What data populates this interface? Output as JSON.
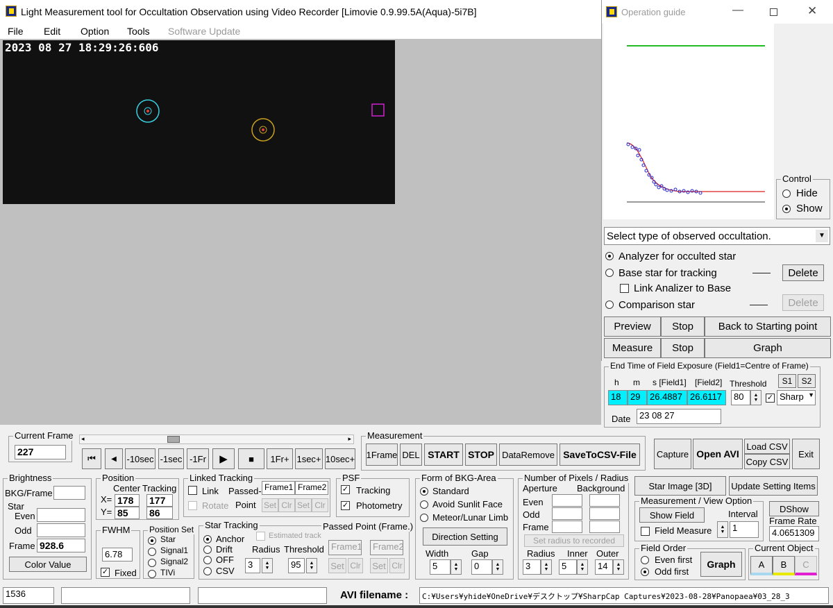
{
  "main": {
    "title": "Light Measurement tool for Occultation Observation using Video Recorder [Limovie 0.9.99.5A(Aqua)-5i7B]",
    "menu": [
      "File",
      "Edit",
      "Option",
      "Tools",
      "Software Update"
    ],
    "video_timestamp": "2023 08 27 18:29:26:606"
  },
  "guide": {
    "title": "Operation guide",
    "control_label": "Control",
    "hide_label": "Hide",
    "show_label": "Show",
    "select_text": "Select type of observed occultation.",
    "analyzer_label": "Analyzer for occulted star",
    "base_label": "Base star for tracking",
    "link_label": "Link Analizer to Base",
    "comparison_label": "Comparison star",
    "delete1": "Delete",
    "delete2": "Delete",
    "preview": "Preview",
    "stop1": "Stop",
    "back": "Back to Starting point",
    "measure": "Measure",
    "stop2": "Stop",
    "graph": "Graph",
    "dash1": "——",
    "dash2": "——"
  },
  "endtime": {
    "title": "End Time of Field Exposure (Field1=Centre of Frame)",
    "h_label": "h",
    "m_label": "m",
    "s_label": "s [Field1]",
    "f2_label": "[Field2]",
    "threshold_label": "Threshold",
    "s1": "S1",
    "s2": "S2",
    "h": "18",
    "m": "29",
    "s1_val": "26.4887",
    "s2_val": "26.6117",
    "threshold": "80",
    "sharp": "Sharp",
    "date_label": "Date",
    "date": "23 08 27"
  },
  "frame": {
    "current_label": "Current Frame",
    "current": "227",
    "nav": [
      "⏮",
      "◀",
      "-10sec",
      "-1sec",
      "-1Fr",
      "▶",
      "■",
      "1Fr+",
      "1sec+",
      "10sec+"
    ]
  },
  "measurement": {
    "title": "Measurement",
    "buttons": [
      "1Frame",
      "DEL",
      "START",
      "STOP",
      "DataRemove",
      "SaveToCSV-File"
    ]
  },
  "right_buttons": {
    "capture": "Capture",
    "open_avi": "Open AVI",
    "load_csv": "Load CSV",
    "copy_csv": "Copy CSV",
    "exit": "Exit",
    "star_image": "Star Image [3D]",
    "update": "Update Setting Items"
  },
  "brightness": {
    "title": "Brightness",
    "bkg_label": "BKG/Frame",
    "star_label": "Star",
    "even_label": "Even",
    "odd_label": "Odd",
    "frame_label": "Frame",
    "frame_value": "928.6",
    "color_value": "Color Value"
  },
  "position": {
    "title": "Position",
    "center": "Center",
    "tracking": "Tracking",
    "x_label": "X=",
    "y_label": "Y=",
    "cx": "178",
    "cy": "85",
    "tx": "177",
    "ty": "86"
  },
  "fwhm": {
    "title": "FWHM",
    "value": "6.78",
    "fixed": "Fixed"
  },
  "position_set": {
    "title": "Position Set",
    "options": [
      "Star",
      "Signal1",
      "Signal2",
      "TIVi"
    ]
  },
  "linked": {
    "title": "Linked Tracking",
    "link": "Link",
    "rotate": "Rotate",
    "passed": "Passed-",
    "point": "Point",
    "frame1": "Frame1",
    "frame2": "Frame2",
    "set": "Set",
    "clr": "Clr"
  },
  "star_tracking": {
    "title": "Star Tracking",
    "options": [
      "Anchor",
      "Drift",
      "OFF",
      "CSV"
    ],
    "estimated": "Estimated track",
    "radius_label": "Radius",
    "threshold_label": "Threshold",
    "radius": "3",
    "threshold": "95",
    "passed_label": "Passed Point (Frame.)",
    "frame1": "Frame1",
    "frame2": "Frame2",
    "set": "Set",
    "clr": "Clr"
  },
  "psf": {
    "title": "PSF",
    "tracking": "Tracking",
    "photometry": "Photometry"
  },
  "bkg_area": {
    "title": "Form of BKG-Area",
    "options": [
      "Standard",
      "Avoid Sunlit Face",
      "Meteor/Lunar Limb"
    ],
    "direction": "Direction Setting",
    "width_label": "Width",
    "gap_label": "Gap",
    "width": "5",
    "gap": "0"
  },
  "pixels": {
    "title": "Number of Pixels / Radius",
    "aperture": "Aperture",
    "background": "Background",
    "even": "Even",
    "odd": "Odd",
    "frame": "Frame",
    "set_radius": "Set  radius to recorded",
    "radius_label": "Radius",
    "inner_label": "Inner",
    "outer_label": "Outer",
    "radius": "3",
    "inner": "5",
    "outer": "14"
  },
  "view_option": {
    "title": "Measurement / View Option",
    "show_field": "Show Field",
    "interval_label": "Interval",
    "field_measure": "Field Measure",
    "interval": "1"
  },
  "dshow": {
    "label": "DShow",
    "rate_label": "Frame Rate",
    "rate": "4.0651309"
  },
  "field_order": {
    "title": "Field Order",
    "even": "Even first",
    "odd": "Odd first",
    "graph": "Graph"
  },
  "current_object": {
    "title": "Current Object",
    "a": "A",
    "b": "B",
    "c": "C"
  },
  "status": {
    "frame_count": "1536",
    "avi_label": "AVI filename :",
    "avi_path": "C:¥Users¥yhide¥OneDrive¥デスクトップ¥SharpCap Captures¥2023-08-28¥Panopaea¥03_28_3"
  },
  "colors": {
    "cyan_field": "#00f0ff",
    "green_line": "#22bb22",
    "red_curve": "#dd2222",
    "blue_points": "#2222cc",
    "object_a": "#a8d8f0",
    "object_b": "#e8e800",
    "object_c": "#e020d0"
  }
}
